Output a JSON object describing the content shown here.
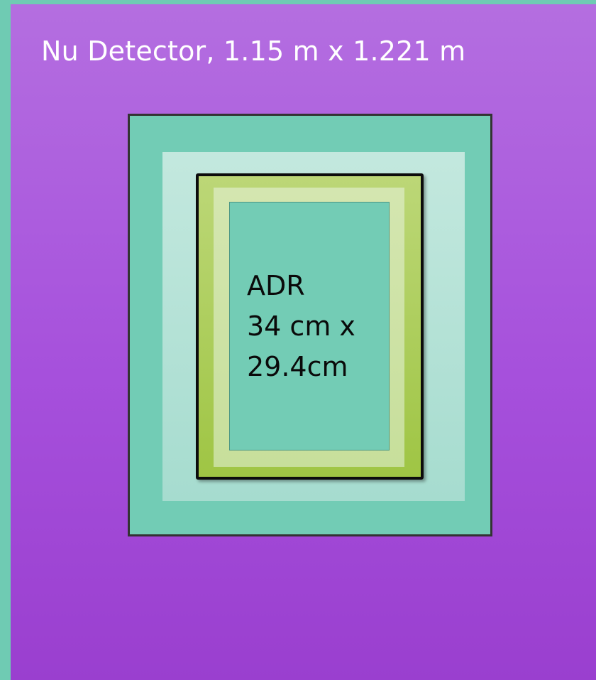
{
  "diagram": {
    "title": "Nu Detector, 1.15 m x 1.221 m",
    "inner_label": {
      "name": "ADR",
      "line2": "34 cm x",
      "line3": "29.4cm"
    }
  },
  "colors": {
    "background_edge": "#6fcbb3",
    "panel_purple": "#a650dc",
    "outer_frame_teal": "#72ccb5",
    "light_band": "#b6e2d6",
    "adr_green": "#a9cc58",
    "adr_light_green": "#cfe3a7",
    "adr_core_teal": "#73ccb5"
  }
}
